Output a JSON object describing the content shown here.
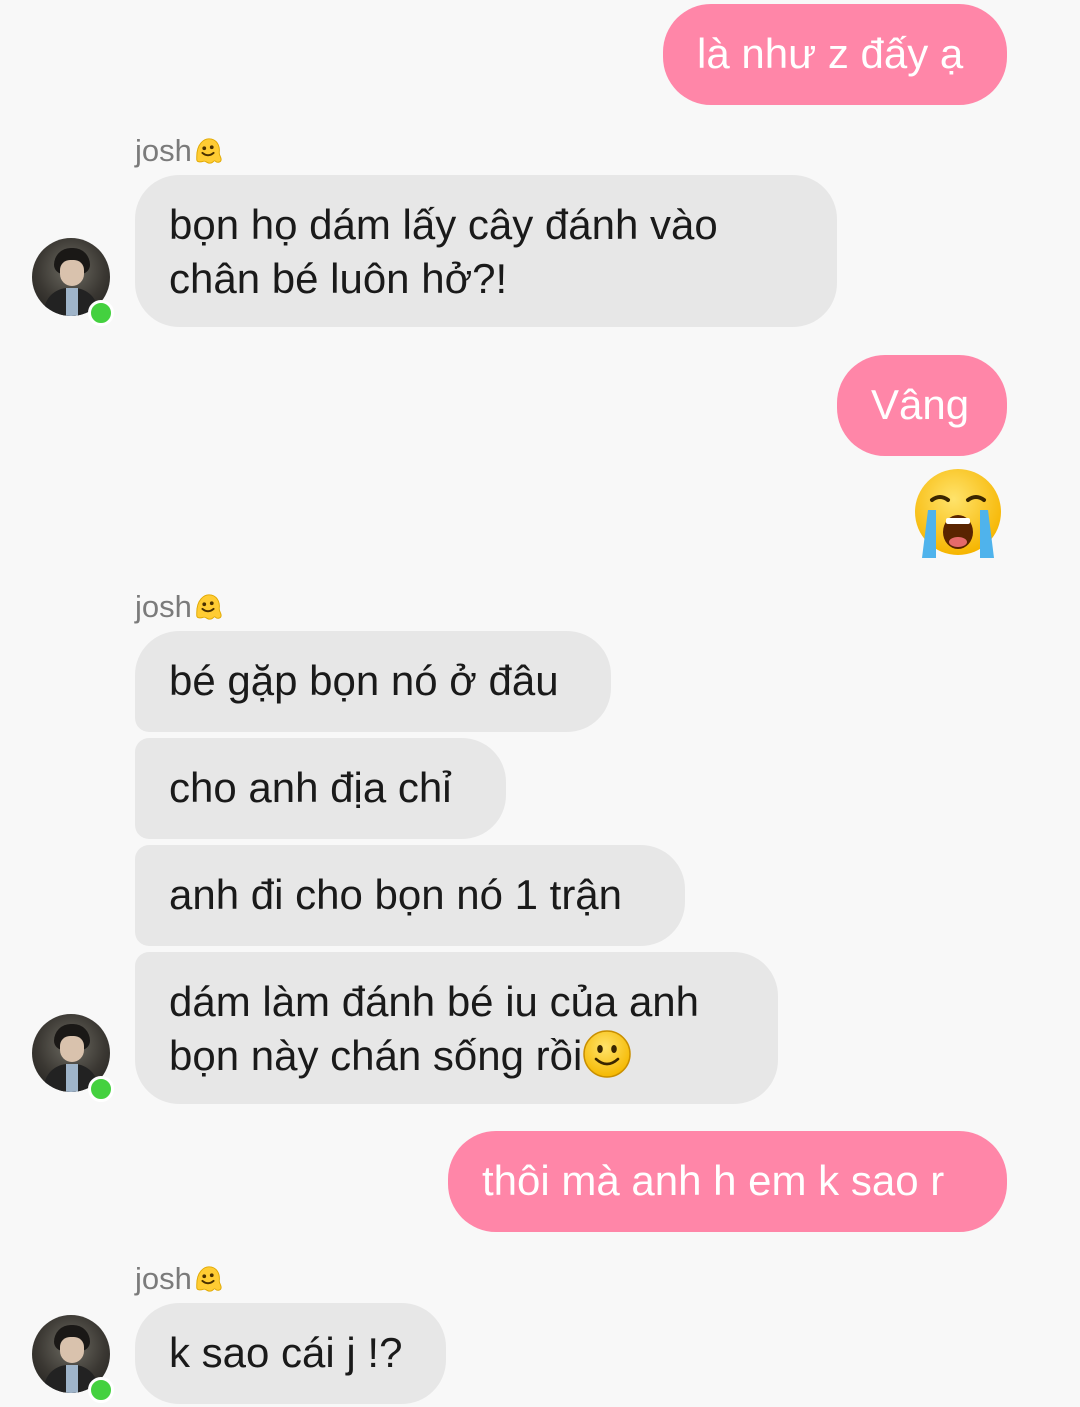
{
  "conversation": {
    "sender_name": "josh",
    "messages": [
      {
        "id": "m1",
        "from": "me",
        "text": "là như z đấy ạ"
      },
      {
        "id": "m2",
        "from": "josh",
        "lines": [
          "bọn họ dám lấy cây đánh vào",
          "chân bé luôn hở?!"
        ]
      },
      {
        "id": "m3",
        "from": "me",
        "text": "Vâng"
      },
      {
        "id": "m4",
        "from": "me",
        "emoji": "loudly-crying-face"
      },
      {
        "id": "m5",
        "from": "josh",
        "text": "bé gặp bọn nó ở đâu"
      },
      {
        "id": "m6",
        "from": "josh",
        "text": "cho anh địa chỉ"
      },
      {
        "id": "m7",
        "from": "josh",
        "text": "anh đi cho bọn nó 1 trận"
      },
      {
        "id": "m8",
        "from": "josh",
        "lines": [
          "dám làm đánh bé iu của anh",
          "bọn này chán sống rồi"
        ],
        "trailing_emoji": "slightly-smiling-face"
      },
      {
        "id": "m9",
        "from": "me",
        "text": "thôi mà anh h em k sao r"
      },
      {
        "id": "m10",
        "from": "josh",
        "text": "k sao cái j !?"
      }
    ]
  },
  "icons": {
    "sender_badge": "melting-face-icon",
    "avatar_status": "online-dot"
  },
  "colors": {
    "outgoing_bubble": "#ff86a8",
    "incoming_bubble": "#e7e7e7",
    "background": "#f8f8f8",
    "online": "#44d13f"
  }
}
